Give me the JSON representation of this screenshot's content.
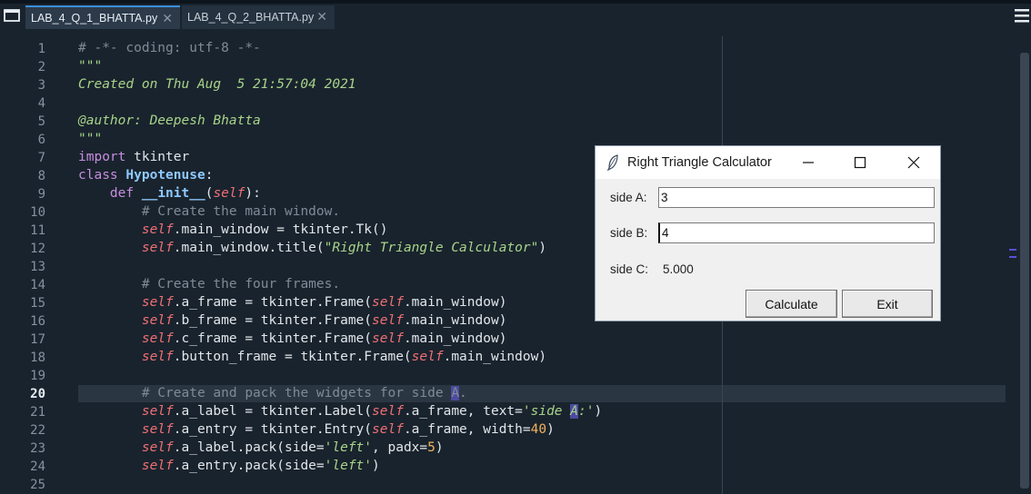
{
  "tabs": [
    {
      "label": "LAB_4_Q_1_BHATTA.py",
      "active": true
    },
    {
      "label": "LAB_4_Q_2_BHATTA.py",
      "active": false
    }
  ],
  "editor": {
    "current_line": 20,
    "line_numbers": [
      "1",
      "2",
      "3",
      "4",
      "5",
      "6",
      "7",
      "8",
      "9",
      "10",
      "11",
      "12",
      "13",
      "14",
      "15",
      "16",
      "17",
      "18",
      "19",
      "20",
      "21",
      "22",
      "23",
      "24",
      "25"
    ]
  },
  "dialog": {
    "title": "Right Triangle Calculator",
    "side_a_label": "side A:",
    "side_a_value": "3",
    "side_b_label": "side B:",
    "side_b_value": "4",
    "side_c_label": "side C:",
    "side_c_value": "5.000",
    "calculate_label": "Calculate",
    "exit_label": "Exit"
  },
  "colors": {
    "editor_bg": "#19232d",
    "comment": "#7f8b96",
    "string": "#a8d48a",
    "keyword": "#c88de0",
    "self": "#ef6f75",
    "number": "#f4b35c",
    "selection": "#4d4aa0"
  },
  "icons": [
    "window-icon",
    "close-icon",
    "menu-icon",
    "feather-icon",
    "minimize-icon",
    "maximize-icon"
  ]
}
